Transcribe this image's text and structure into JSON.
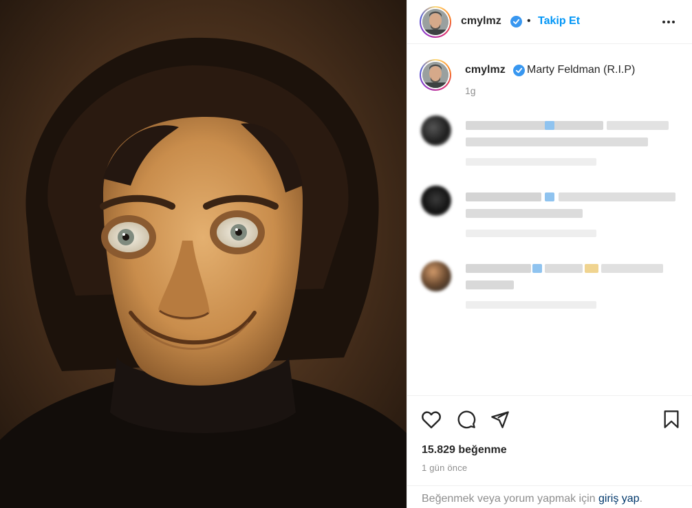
{
  "post": {
    "username": "cmylmz",
    "follow_label": "Takip Et",
    "separator": "•",
    "caption": "Marty Feldman (R.I.P)",
    "caption_age": "1g",
    "likes": "15.829 beğenme",
    "date": "1 gün önce",
    "login_prefix": "Beğenmek veya yorum yapmak için ",
    "login_link": "giriş yap",
    "login_suffix": "."
  },
  "icons": {
    "like": "heart-icon",
    "comment": "comment-icon",
    "share": "paper-plane-icon",
    "save": "bookmark-icon",
    "more": "more-options-icon",
    "verified": "verified-badge-icon"
  },
  "colors": {
    "accent": "#0095f6",
    "verified": "#3897f0",
    "muted": "#8e8e8e",
    "text": "#262626",
    "link": "#00376b"
  }
}
